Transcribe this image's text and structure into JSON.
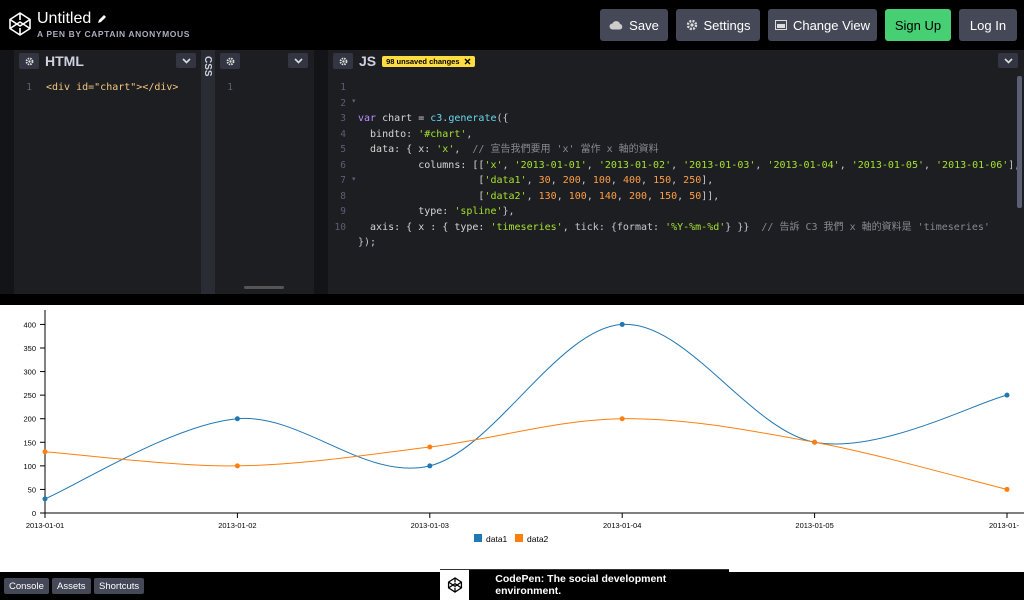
{
  "header": {
    "title": "Untitled",
    "subtitle": "A PEN BY CAPTAIN ANONYMOUS",
    "buttons": {
      "save": "Save",
      "settings": "Settings",
      "change_view": "Change View",
      "signup": "Sign Up",
      "login": "Log In"
    },
    "colors": {
      "signup": "#47cf73",
      "button": "#444857"
    }
  },
  "editors": {
    "html": {
      "label": "HTML",
      "line_numbers": "1",
      "code_line1": "<div id=\"chart\"></div>"
    },
    "css": {
      "label": "CSS",
      "line_numbers": "1"
    },
    "js": {
      "label": "JS",
      "badge": "98 unsaved changes",
      "line_numbers": "1\n2\n3\n4\n5\n6\n7\n8\n9\n10"
    }
  },
  "chart_data": {
    "type": "line",
    "x": [
      "2013-01-01",
      "2013-01-02",
      "2013-01-03",
      "2013-01-04",
      "2013-01-05",
      "2013-01-06"
    ],
    "series": [
      {
        "name": "data1",
        "values": [
          30,
          200,
          100,
          400,
          150,
          250
        ],
        "color": "#1f77b4"
      },
      {
        "name": "data2",
        "values": [
          130,
          100,
          140,
          200,
          150,
          50
        ],
        "color": "#ff7f0e"
      }
    ],
    "yticks": [
      0,
      50,
      100,
      150,
      200,
      250,
      300,
      350,
      400
    ],
    "ylim": [
      0,
      420
    ],
    "xtick_labels": [
      "2013-01-01",
      "2013-01-02",
      "2013-01-03",
      "2013-01-04",
      "2013-01-05",
      "2013-01-"
    ],
    "grid": false,
    "legend": "bottom-center"
  },
  "footer": {
    "console": "Console",
    "assets": "Assets",
    "shortcuts": "Shortcuts",
    "promo": "CodePen: The social development environment."
  }
}
